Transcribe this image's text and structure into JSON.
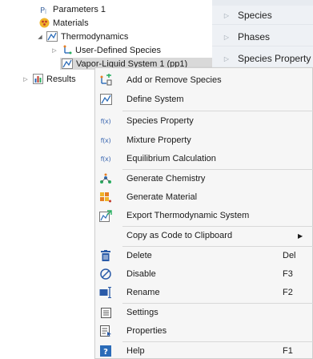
{
  "tree": {
    "items": [
      {
        "label": "Parameters 1",
        "icon": "parameters-icon",
        "indent": 1
      },
      {
        "label": "Materials",
        "icon": "materials-icon",
        "indent": 1
      },
      {
        "label": "Thermodynamics",
        "icon": "thermodynamics-icon",
        "indent": 0,
        "expanded": true
      },
      {
        "label": "User-Defined Species",
        "icon": "species-icon",
        "indent": 2,
        "collapsed": true
      },
      {
        "label": "Vapor-Liquid System 1 (pp1)",
        "icon": "system-icon",
        "indent": 3,
        "selected": true
      },
      {
        "label": "Results",
        "icon": "results-icon",
        "indent": -1,
        "collapsed": true
      }
    ]
  },
  "right_panel": {
    "rows": [
      {
        "label": "Species"
      },
      {
        "label": "Phases"
      },
      {
        "label": "Species Property"
      }
    ]
  },
  "context_menu": {
    "items": [
      {
        "label": "Add or Remove Species",
        "icon": "add-remove-species-icon"
      },
      {
        "label": "Define System",
        "icon": "define-system-icon"
      },
      {
        "label": "Species Property",
        "icon": "fx-icon"
      },
      {
        "label": "Mixture Property",
        "icon": "fx-icon"
      },
      {
        "label": "Equilibrium Calculation",
        "icon": "fx-icon"
      },
      {
        "label": "Generate Chemistry",
        "icon": "generate-chemistry-icon"
      },
      {
        "label": "Generate Material",
        "icon": "generate-material-icon"
      },
      {
        "label": "Export Thermodynamic System",
        "icon": "export-system-icon"
      },
      {
        "label": "Copy as Code to Clipboard",
        "icon": "",
        "submenu": true
      },
      {
        "label": "Delete",
        "icon": "delete-icon",
        "shortcut": "Del"
      },
      {
        "label": "Disable",
        "icon": "disable-icon",
        "shortcut": "F3"
      },
      {
        "label": "Rename",
        "icon": "rename-icon",
        "shortcut": "F2"
      },
      {
        "label": "Settings",
        "icon": "settings-icon"
      },
      {
        "label": "Properties",
        "icon": "properties-icon"
      },
      {
        "label": "Help",
        "icon": "help-icon",
        "shortcut": "F1"
      }
    ],
    "fx_text": "f(x)"
  },
  "colors": {
    "menu_bg": "#f6f6f6",
    "selected_bg": "#d9d9d9",
    "panel_bg": "#eef1f5",
    "accent_blue": "#3a66b0"
  }
}
